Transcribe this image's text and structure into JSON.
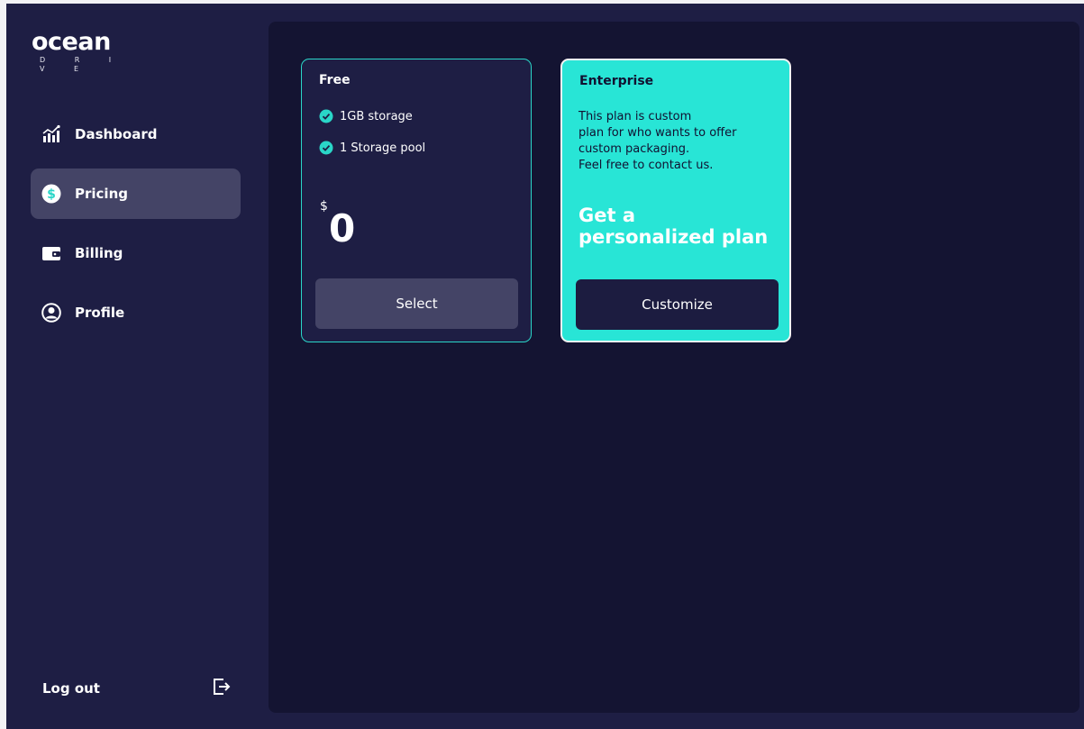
{
  "brand": {
    "name": "ocean",
    "subtitle": "D R I V E"
  },
  "sidebar": {
    "items": [
      {
        "label": "Dashboard",
        "icon": "chart-icon",
        "active": false
      },
      {
        "label": "Pricing",
        "icon": "dollar-icon",
        "active": true
      },
      {
        "label": "Billing",
        "icon": "wallet-icon",
        "active": false
      },
      {
        "label": "Profile",
        "icon": "user-icon",
        "active": false
      }
    ],
    "logout": {
      "label": "Log out",
      "icon": "logout-icon"
    }
  },
  "plans": {
    "free": {
      "title": "Free",
      "features": [
        "1GB storage",
        "1 Storage pool"
      ],
      "currency": "$",
      "price": "0",
      "button": "Select"
    },
    "enterprise": {
      "title": "Enterprise",
      "description": [
        "This plan is custom",
        "plan for who wants to offer",
        "custom packaging.",
        "Feel free to contact us."
      ],
      "headline": [
        "Get a",
        "personalized plan"
      ],
      "button": "Customize"
    }
  },
  "colors": {
    "accent": "#28e5d6",
    "sidebar_bg": "#1e1e44",
    "main_bg": "#141432",
    "active_item": "#444466"
  }
}
